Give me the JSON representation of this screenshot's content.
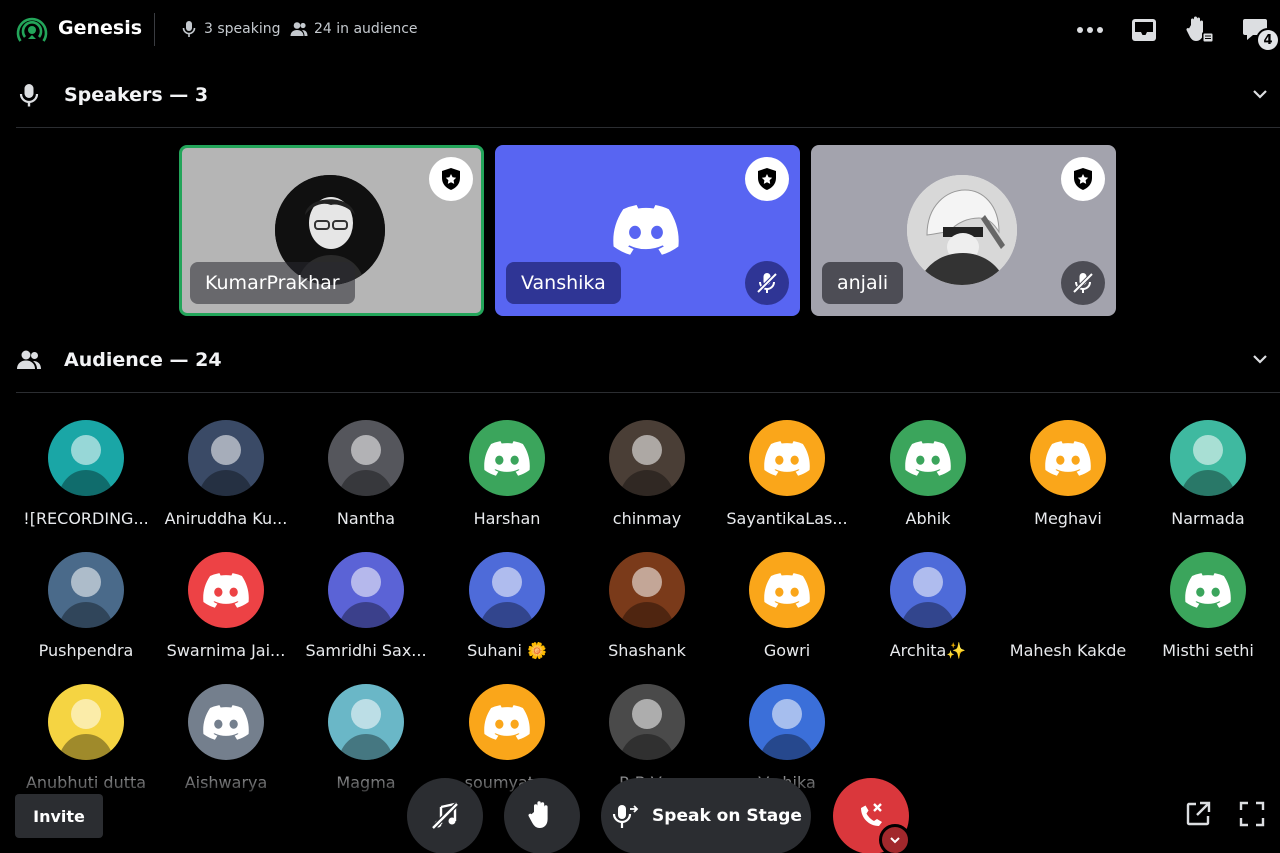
{
  "header": {
    "title": "Genesis",
    "speaking": "3 speaking",
    "audience_count": "24 in audience",
    "inbox_badge": "4"
  },
  "speakers_section": {
    "label": "Speakers — 3"
  },
  "audience_section": {
    "label": "Audience — 24"
  },
  "speakers": [
    {
      "name": "KumarPrakhar",
      "speaking": true,
      "tile_color": "#b5b5b5"
    },
    {
      "name": "Vanshika",
      "muted": true,
      "tile_color": "#5865f2"
    },
    {
      "name": "anjali",
      "muted": true,
      "tile_color": "#a3a3ad"
    }
  ],
  "audience": [
    {
      "name": "![RECORDING...",
      "avatar": "bear-avatar",
      "color": "#1aa6a6"
    },
    {
      "name": "Aniruddha Ku...",
      "avatar": "anime-white-hair-avatar",
      "color": "#3a4a66"
    },
    {
      "name": "Nantha",
      "avatar": "anime-dark-hair-avatar",
      "color": "#55565c"
    },
    {
      "name": "Harshan",
      "avatar": "discord-avatar",
      "color": "#3ba55c"
    },
    {
      "name": "chinmay",
      "avatar": "photo-avatar",
      "color": "#4a3e36"
    },
    {
      "name": "SayantikaLas...",
      "avatar": "discord-avatar",
      "color": "#faa61a"
    },
    {
      "name": "Abhik",
      "avatar": "discord-avatar",
      "color": "#3ba55c"
    },
    {
      "name": "Meghavi",
      "avatar": "discord-avatar",
      "color": "#faa61a"
    },
    {
      "name": "Narmada",
      "avatar": "cartoon-avatar",
      "color": "#3fb9a0"
    },
    {
      "name": "Pushpendra",
      "avatar": "photo-avatar",
      "color": "#4a6a8a"
    },
    {
      "name": "Swarnima Jai...",
      "avatar": "discord-avatar",
      "color": "#ed4245"
    },
    {
      "name": "Samridhi Sax...",
      "avatar": "cartoon-avatar",
      "color": "#5b63d6"
    },
    {
      "name": "Suhani 🌼",
      "avatar": "cartoon-duck-avatar",
      "color": "#4e6bd9"
    },
    {
      "name": "Shashank",
      "avatar": "photo-avatar",
      "color": "#7a3a1a"
    },
    {
      "name": "Gowri",
      "avatar": "discord-avatar",
      "color": "#faa61a"
    },
    {
      "name": "Archita✨",
      "avatar": "cartoon-duck-avatar",
      "color": "#4e6bd9"
    },
    {
      "name": "Mahesh Kakde",
      "avatar": "none",
      "color": "#000000"
    },
    {
      "name": "Misthi sethi",
      "avatar": "discord-avatar",
      "color": "#3ba55c"
    },
    {
      "name": "Anubhuti dutta",
      "avatar": "cartoon-avatar",
      "color": "#f5d442"
    },
    {
      "name": "Aishwarya",
      "avatar": "discord-avatar",
      "color": "#747f8d"
    },
    {
      "name": "Magma",
      "avatar": "anime-avatar",
      "color": "#6ab7c7"
    },
    {
      "name": "soumyat...",
      "avatar": "discord-avatar",
      "color": "#faa61a"
    },
    {
      "name": "R.B.V...",
      "avatar": "anime-avatar",
      "color": "#4a4a4a"
    },
    {
      "name": "V...hika",
      "avatar": "cartoon-avatar",
      "color": "#3b6fd9"
    }
  ],
  "controls": {
    "invite": "Invite",
    "speak_on_stage": "Speak on Stage"
  },
  "colors": {
    "speaking_ring": "#23a55a",
    "blurple": "#5865f2",
    "danger": "#da373c"
  }
}
